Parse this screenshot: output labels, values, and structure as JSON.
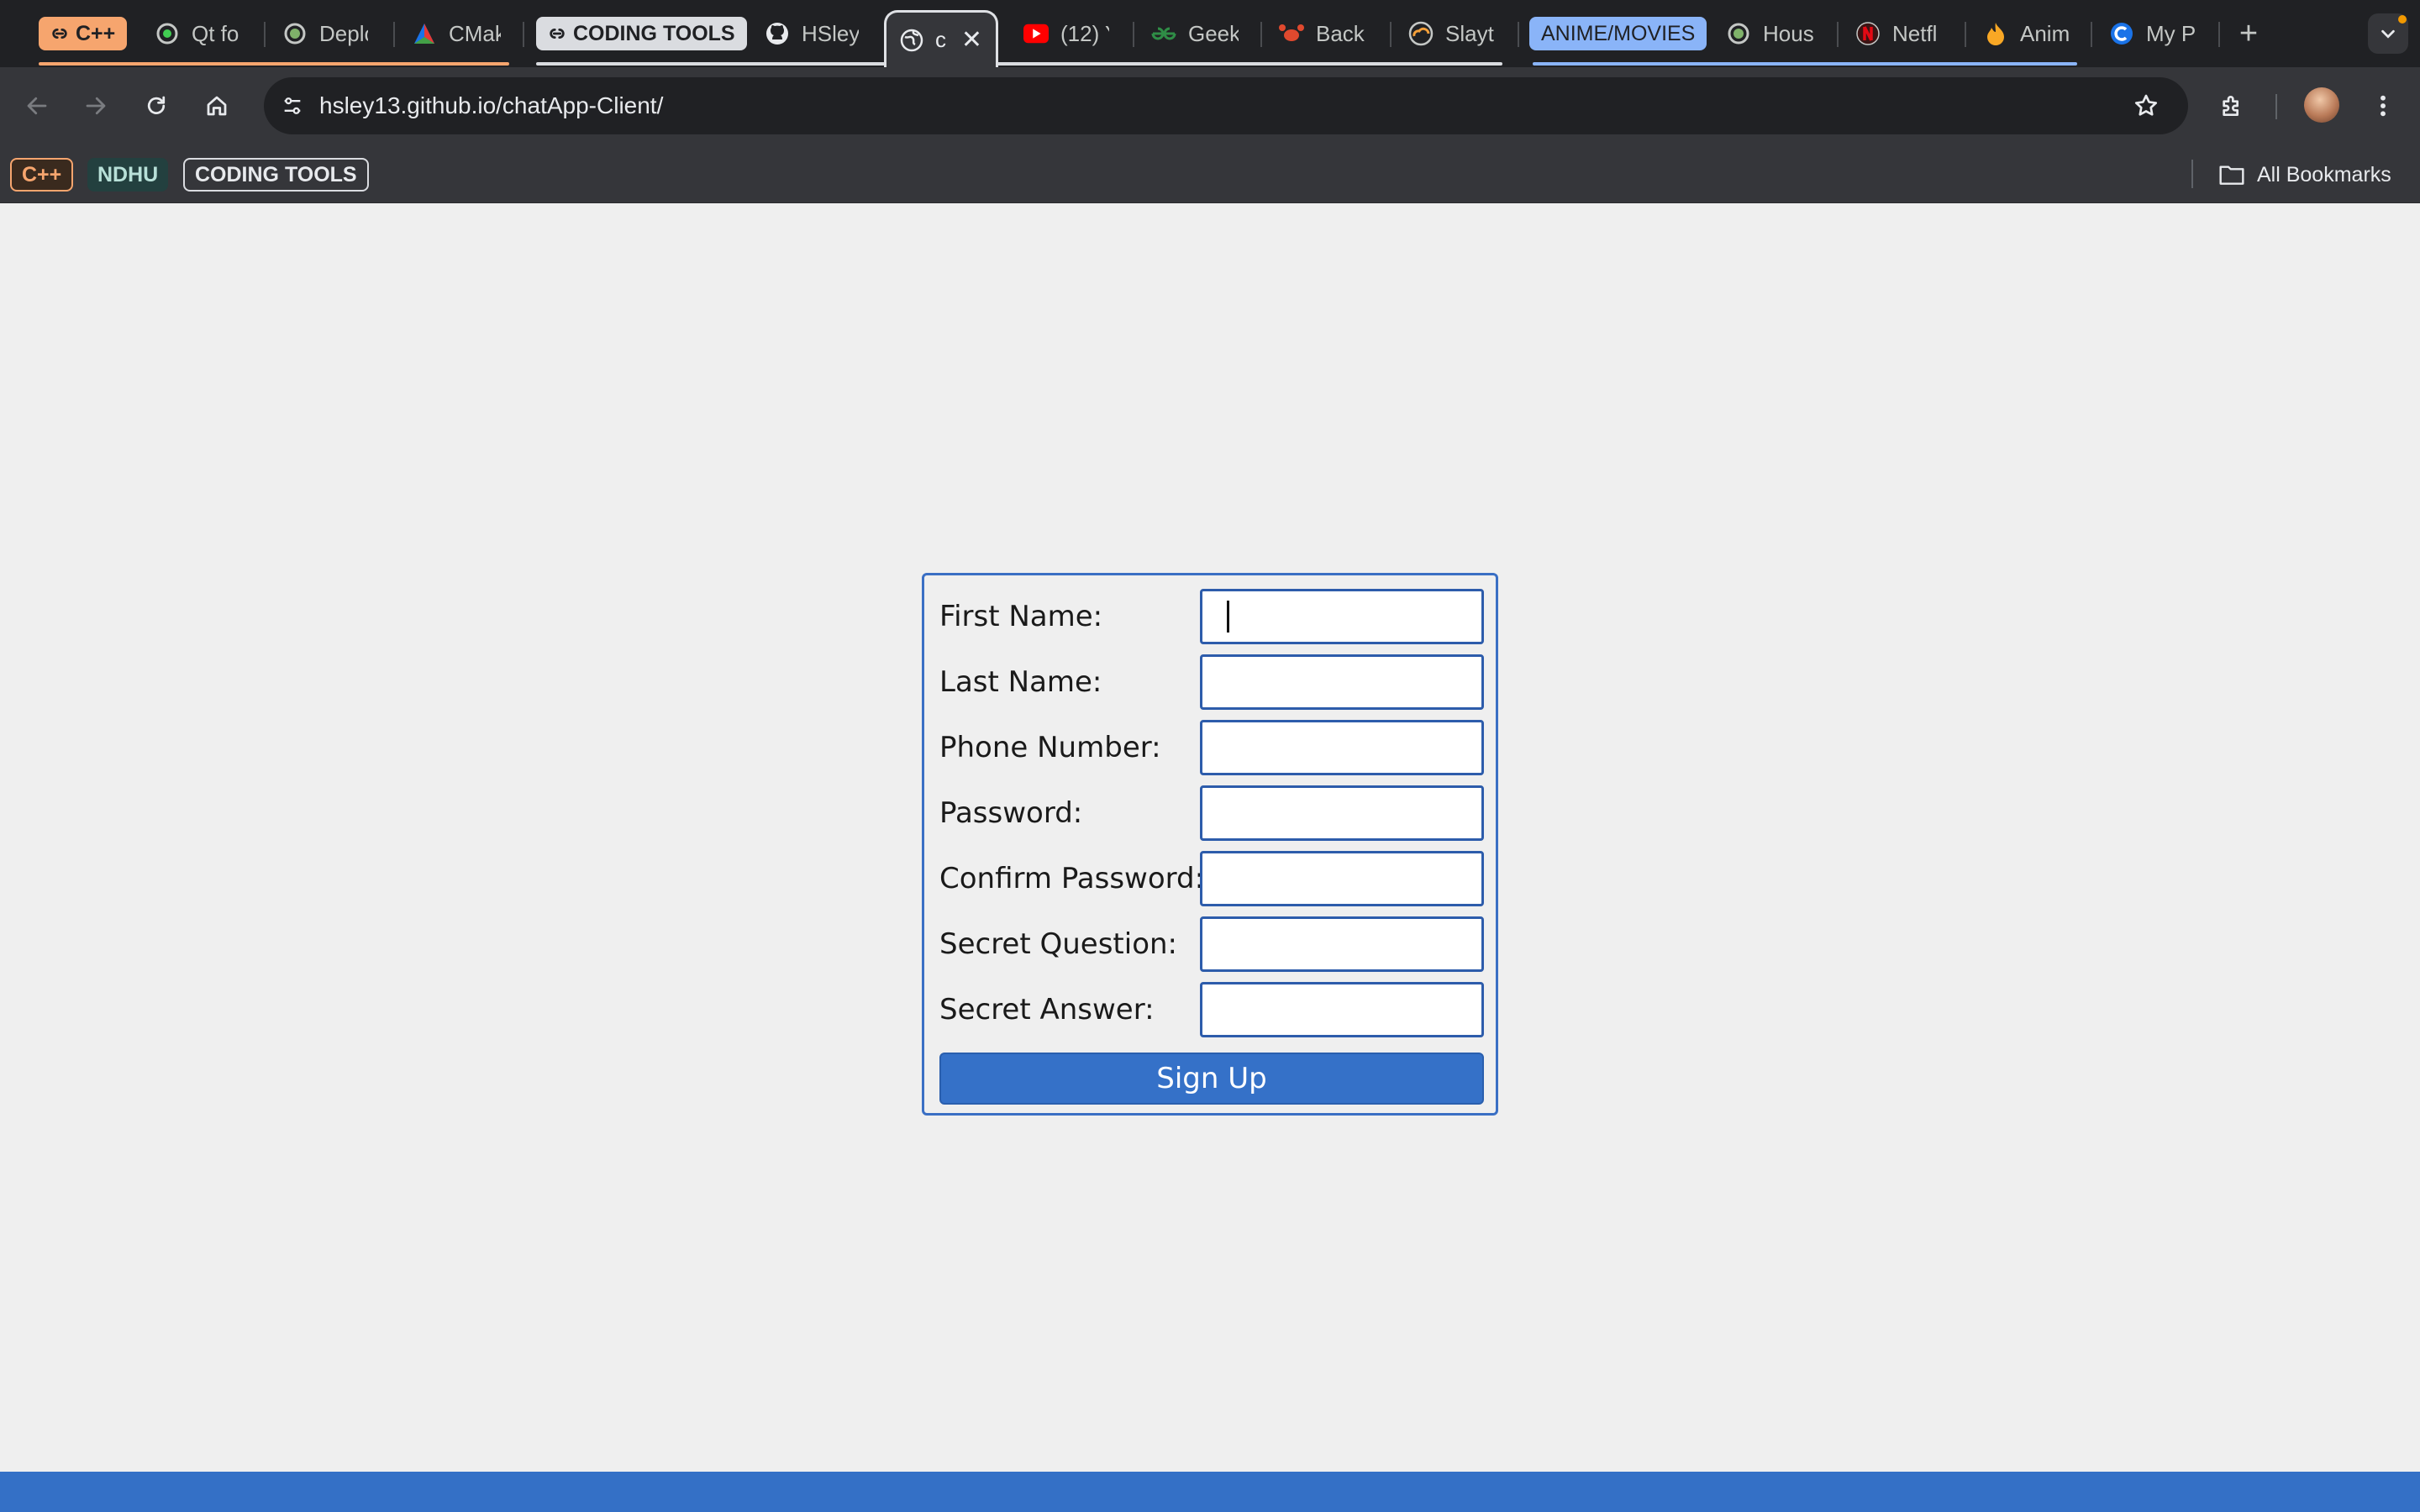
{
  "tabs": [
    {
      "title": "Qt fo",
      "icon": "qt-favicon"
    },
    {
      "title": "Deplo",
      "icon": "green-globe-favicon"
    },
    {
      "title": "CMak",
      "icon": "cmake-triangle-favicon"
    },
    {
      "title": "HSley",
      "icon": "github-favicon"
    },
    {
      "title": "(12) Y",
      "icon": "youtube-favicon"
    },
    {
      "title": "Geek",
      "icon": "geeksforgeeks-favicon"
    },
    {
      "title": "Back",
      "icon": "crab-favicon"
    },
    {
      "title": "Slayt",
      "icon": "cloud-favicon"
    },
    {
      "title": "Hous",
      "icon": "green-globe-favicon"
    },
    {
      "title": "Netfl",
      "icon": "netflix-favicon"
    },
    {
      "title": "Anim",
      "icon": "flame-favicon"
    },
    {
      "title": "My P",
      "icon": "c-favicon"
    }
  ],
  "active_tab": {
    "title": "c",
    "icon": "globe-favicon"
  },
  "tab_groups": {
    "cpp": {
      "label": "C++",
      "color": "#f6a56e",
      "icon": "link-icon"
    },
    "coding_tools": {
      "label": "CODING TOOLS",
      "color": "#dadce0",
      "icon": "link-icon"
    },
    "anime_movies": {
      "label": "ANIME/MOVIES",
      "color": "#8ab4f8"
    }
  },
  "toolbar": {
    "url": "hsley13.github.io/chatApp-Client/"
  },
  "bookmarks": {
    "items": [
      {
        "label": "C++",
        "color": "#f6a56e"
      },
      {
        "label": "NDHU",
        "color": "#1e6b6b"
      },
      {
        "label": "CODING TOOLS",
        "color": "#dadce0"
      }
    ],
    "all_bookmarks": "All Bookmarks"
  },
  "form": {
    "fields": [
      {
        "label": "First Name:",
        "value": ""
      },
      {
        "label": "Last Name:",
        "value": ""
      },
      {
        "label": "Phone Number:",
        "value": ""
      },
      {
        "label": "Password:",
        "value": ""
      },
      {
        "label": "Confirm Password:",
        "value": ""
      },
      {
        "label": "Secret Question:",
        "value": ""
      },
      {
        "label": "Secret Answer:",
        "value": ""
      }
    ],
    "submit_label": "Sign Up",
    "accent": "#3571c8"
  }
}
